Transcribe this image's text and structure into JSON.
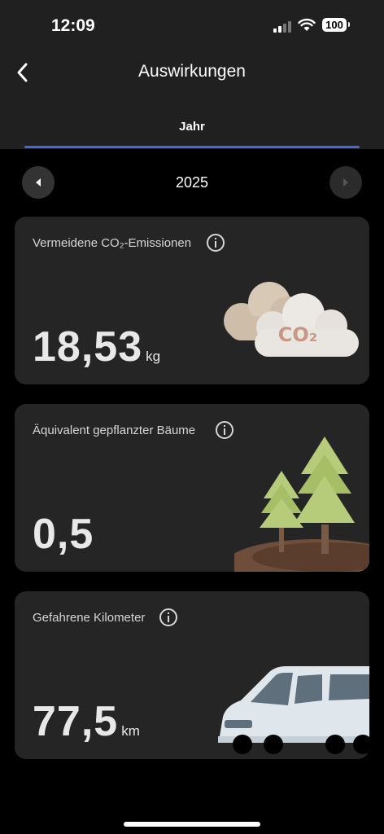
{
  "status_bar": {
    "time": "12:09",
    "battery": "100"
  },
  "header": {
    "title": "Auswirkungen",
    "tab": "Jahr"
  },
  "year_nav": {
    "year": "2025"
  },
  "cards": [
    {
      "label": "Vermeidene CO₂-Emissionen",
      "value": "18,53",
      "unit": "kg",
      "illustration_text": "CO₂"
    },
    {
      "label": "Äquivalent gepflanzter Bäume",
      "value": "0,5",
      "unit": ""
    },
    {
      "label": "Gefahrene Kilometer",
      "value": "77,5",
      "unit": "km"
    }
  ],
  "icons": [
    "back-arrow-icon",
    "info-icon",
    "chevron-left-icon",
    "chevron-right-icon",
    "cloud-co2-icon",
    "trees-icon",
    "van-icon"
  ]
}
